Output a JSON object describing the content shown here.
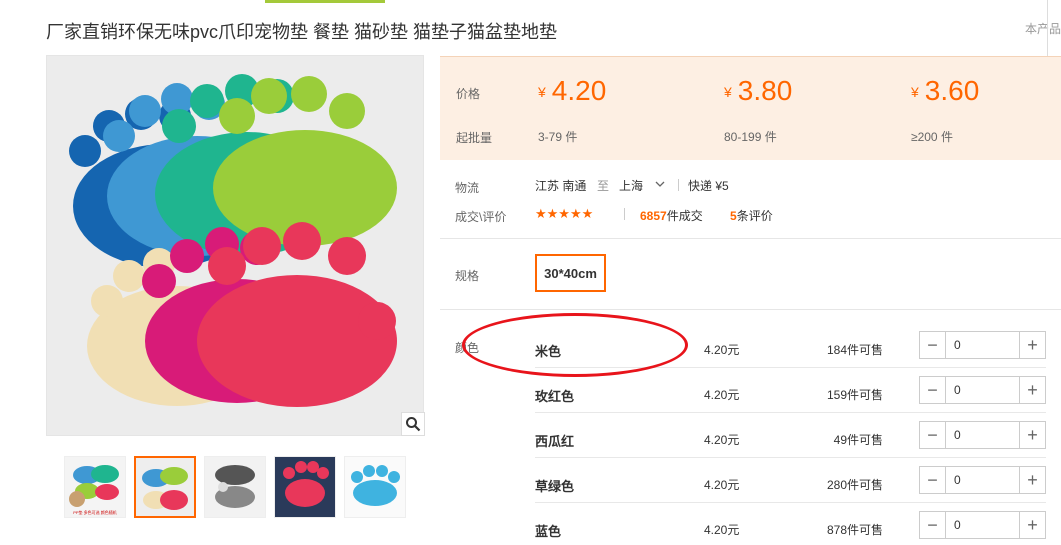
{
  "product": {
    "title": "厂家直销环保无味pvc爪印宠物垫 餐垫 猫砂垫 猫垫子猫盆垫地垫",
    "top_right_text": "本产品"
  },
  "gallery": {
    "thumbnail_count": 5,
    "active_thumbnail": 2,
    "zoom_icon": "search-icon",
    "thumb_caption": "PP垫 多色可选 颜色随机"
  },
  "price_panel": {
    "price_label": "价格",
    "moq_label": "起批量",
    "currency": "¥",
    "tiers": [
      {
        "price": "4.20",
        "qty": "3-79 件"
      },
      {
        "price": "3.80",
        "qty": "80-199 件"
      },
      {
        "price": "3.60",
        "qty": "≥200 件"
      }
    ],
    "accent_color": "#ff6600"
  },
  "logistics": {
    "label": "物流",
    "origin": "江苏 南通",
    "to": "至",
    "dest": "上海",
    "express": "快递 ¥5"
  },
  "reviews": {
    "label": "成交\\评价",
    "stars": "★★★★★",
    "deals_count": "6857",
    "deals_suffix": "件成交",
    "review_count": "5",
    "review_suffix": "条评价"
  },
  "spec": {
    "label": "规格",
    "selected": "30*40cm"
  },
  "color": {
    "label": "颜色",
    "items": [
      {
        "name": "米色",
        "price": "4.20元",
        "stock": "184件可售",
        "qty": "0"
      },
      {
        "name": "玫红色",
        "price": "4.20元",
        "stock": "159件可售",
        "qty": "0"
      },
      {
        "name": "西瓜红",
        "price": "4.20元",
        "stock": "49件可售",
        "qty": "0"
      },
      {
        "name": "草绿色",
        "price": "4.20元",
        "stock": "280件可售",
        "qty": "0"
      },
      {
        "name": "蓝色",
        "price": "4.20元",
        "stock": "878件可售",
        "qty": "0"
      }
    ]
  },
  "stepper_labels": {
    "minus": "−",
    "plus": "+"
  }
}
